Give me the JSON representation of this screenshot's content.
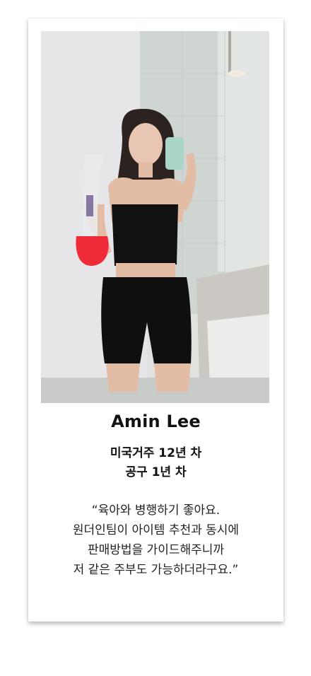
{
  "testimonial": {
    "name": "Amin Lee",
    "meta_lines": [
      "미국거주 12년 차",
      "공구 1년 차"
    ],
    "quote_lines": [
      "“육아와 병행하기 좋아요.",
      "원더인팀이 아이템 추천과 동시에",
      "판매방법을 가이드해주니까",
      "저 같은 주부도 가능하더라구요.”"
    ]
  }
}
